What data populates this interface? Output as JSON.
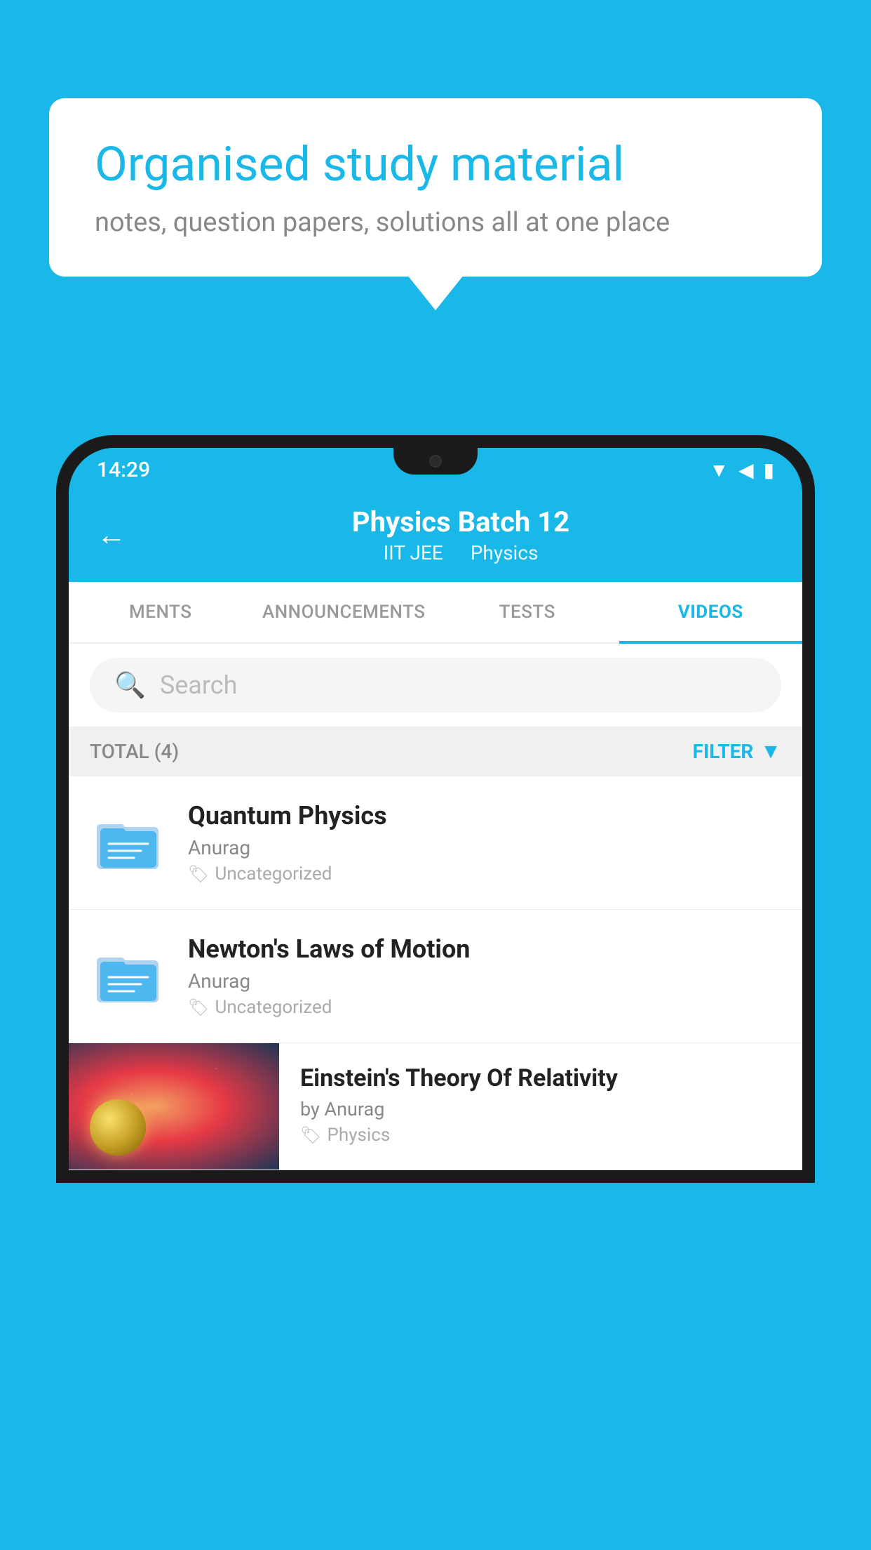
{
  "background": {
    "color": "#1ab8e8"
  },
  "hero": {
    "title": "Organised study material",
    "subtitle": "notes, question papers, solutions all at one place"
  },
  "phone": {
    "status_bar": {
      "time": "14:29",
      "icons": "▼◀▮"
    },
    "header": {
      "title": "Physics Batch 12",
      "subtitle_part1": "IIT JEE",
      "subtitle_part2": "Physics",
      "back_label": "←"
    },
    "tabs": [
      {
        "label": "MENTS",
        "active": false
      },
      {
        "label": "ANNOUNCEMENTS",
        "active": false
      },
      {
        "label": "TESTS",
        "active": false
      },
      {
        "label": "VIDEOS",
        "active": true
      }
    ],
    "search": {
      "placeholder": "Search"
    },
    "filter": {
      "total_label": "TOTAL (4)",
      "filter_label": "FILTER"
    },
    "videos": [
      {
        "id": 1,
        "title": "Quantum Physics",
        "author": "Anurag",
        "tag": "Uncategorized",
        "type": "folder"
      },
      {
        "id": 2,
        "title": "Newton's Laws of Motion",
        "author": "Anurag",
        "tag": "Uncategorized",
        "type": "folder"
      },
      {
        "id": 3,
        "title": "Einstein's Theory Of Relativity",
        "author": "by Anurag",
        "tag": "Physics",
        "type": "video"
      }
    ]
  }
}
